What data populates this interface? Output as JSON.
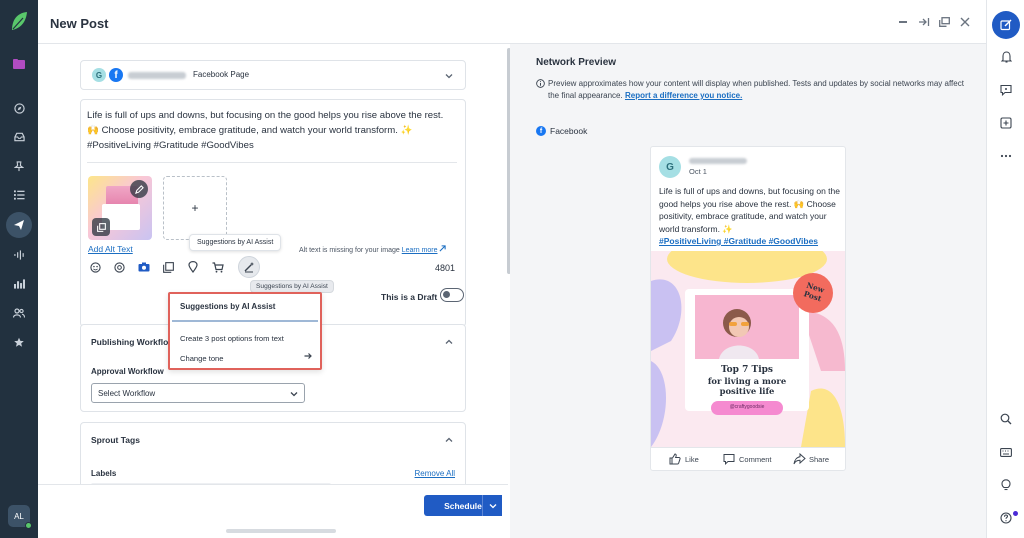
{
  "window": {
    "title": "New Post",
    "controls": [
      "minimize-icon",
      "expand-icon",
      "popout-icon",
      "close-icon"
    ]
  },
  "left_nav": {
    "items": [
      "folder-icon",
      "compass-icon",
      "inbox-icon",
      "pin-icon",
      "list-icon",
      "send-icon",
      "audio-icon",
      "chart-icon",
      "people-icon",
      "star-icon"
    ],
    "active": "send-icon",
    "avatar_initials": "AL"
  },
  "composer": {
    "profile": {
      "avatar_letter": "G",
      "network": "f",
      "page_type": "Facebook Page"
    },
    "post_text_line1": "Life is full of ups and downs, but focusing on the good helps you rise above the rest.",
    "post_text_line2": "🙌 Choose positivity, embrace gratitude, and watch your world transform. ✨",
    "post_text_line3": "#PositiveLiving #Gratitude #GoodVibes",
    "add_media": "+",
    "alt_text_link": "Add Alt Text",
    "alt_warning": "Alt text is missing for your image",
    "learn_more": "Learn more",
    "tooltip_top": "Suggestions by AI Assist",
    "tooltip_bottom": "Suggestions by AI Assist",
    "char_count": "4801",
    "draft_label": "This is a Draft",
    "draft_on": false,
    "ai_menu": {
      "title": "Suggestions by AI Assist",
      "options": [
        "Create 3 post options from text",
        "Change tone"
      ]
    },
    "publishing_workflow": {
      "title": "Publishing Workflow",
      "label": "Approval Workflow",
      "select_value": "Select Workflow"
    },
    "sprout_tags": {
      "title": "Sprout Tags",
      "labels_label": "Labels",
      "remove_all": "Remove All"
    },
    "schedule_button": "Schedule"
  },
  "preview": {
    "title": "Network Preview",
    "note": "Preview approximates how your content will display when published. Tests and updates by social networks may affect the final appearance.",
    "report_link": "Report a difference you notice.",
    "network": "Facebook",
    "post": {
      "avatar_letter": "G",
      "date": "Oct 1",
      "text": "Life is full of ups and downs, but focusing on the good helps you rise above the rest. 🙌 Choose positivity, embrace gratitude, and watch your world transform. ✨",
      "hashtags": "#PositiveLiving #Gratitude #GoodVibes",
      "image": {
        "badge": "New Post",
        "headline_line1": "Top 7 Tips",
        "headline_line2": "for living a more",
        "headline_line3": "positive life",
        "handle": "@craftygoodsie"
      },
      "actions": [
        "Like",
        "Comment",
        "Share"
      ]
    }
  },
  "right_rail": {
    "items": [
      "compose-icon",
      "bell-icon",
      "message-icon",
      "add-task-icon",
      "more-icon",
      "search-icon",
      "keyboard-icon",
      "lightbulb-icon",
      "help-icon"
    ]
  },
  "colors": {
    "sidebar": "#22313f",
    "primary": "#205bc4",
    "highlight": "#e0625b",
    "link": "#1b6ec2"
  }
}
